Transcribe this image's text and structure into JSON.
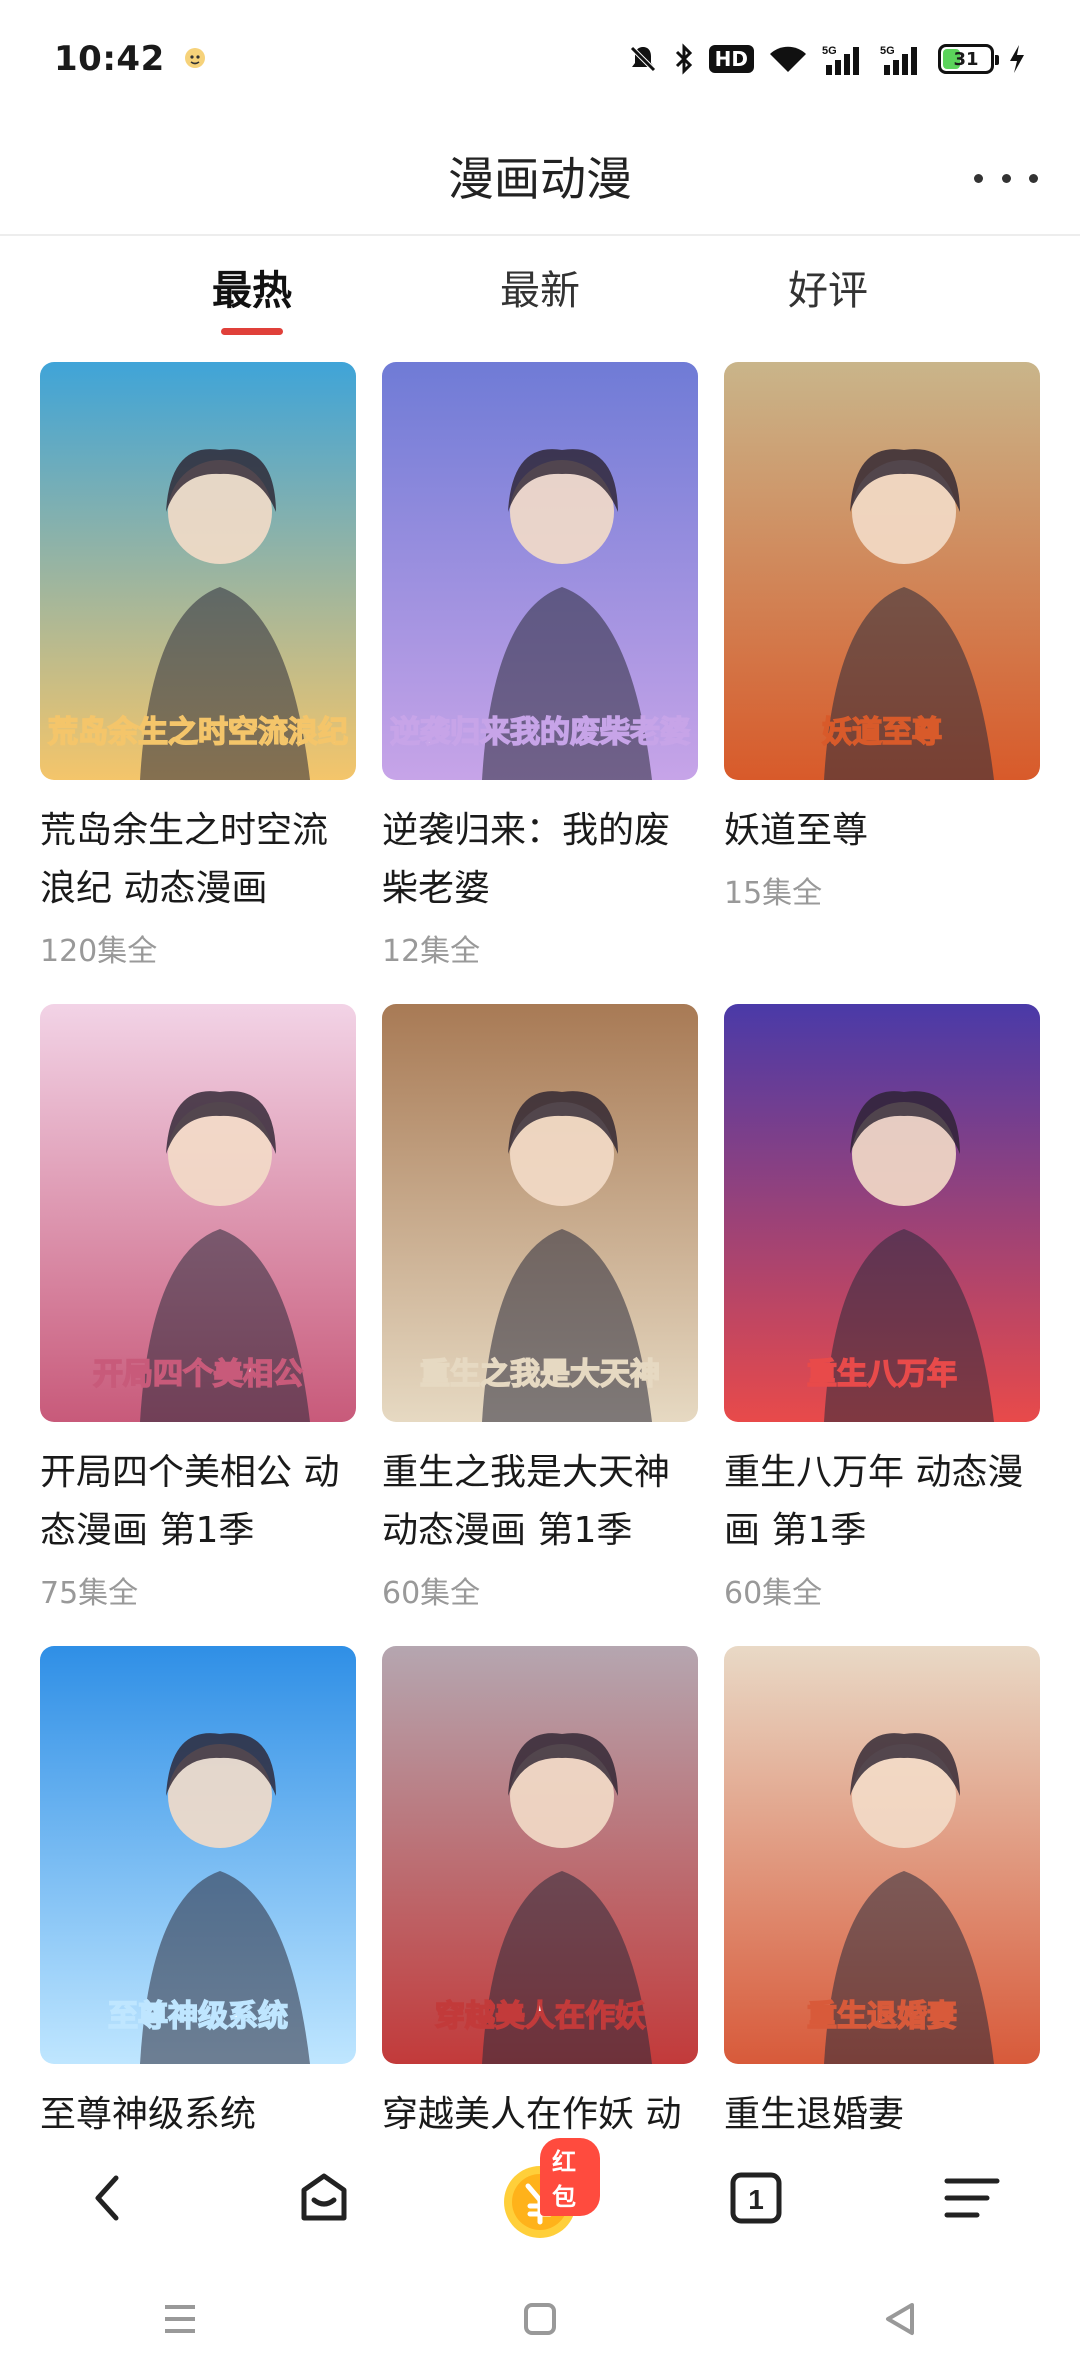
{
  "status_bar": {
    "time": "10:42",
    "network_badge": "HD",
    "signal_1": "5G",
    "signal_2": "5G",
    "battery_level": "31"
  },
  "header": {
    "title": "漫画动漫",
    "more_icon": "more-dots-icon"
  },
  "tabs": [
    {
      "label": "最热",
      "active": true
    },
    {
      "label": "最新",
      "active": false
    },
    {
      "label": "好评",
      "active": false
    }
  ],
  "items": [
    {
      "title": "荒岛余生之时空流浪纪 动态漫画",
      "episodes": "120集全"
    },
    {
      "title": "逆袭归来：我的废柴老婆",
      "episodes": "12集全"
    },
    {
      "title": "妖道至尊",
      "episodes": "15集全"
    },
    {
      "title": "开局四个美相公 动态漫画 第1季",
      "episodes": "75集全"
    },
    {
      "title": "重生之我是大天神 动态漫画 第1季",
      "episodes": "60集全"
    },
    {
      "title": "重生八万年 动态漫画 第1季",
      "episodes": "60集全"
    },
    {
      "title": "至尊神级系统",
      "episodes": ""
    },
    {
      "title": "穿越美人在作妖 动",
      "episodes": ""
    },
    {
      "title": "重生退婚妻",
      "episodes": ""
    }
  ],
  "covers": [
    {
      "caption": "荒岛余生之时空流浪纪",
      "accent": "#3fa4d8",
      "accent2": "#f4c56a"
    },
    {
      "caption": "逆袭归来我的废柴老婆",
      "accent": "#6f7bd6",
      "accent2": "#c7a4e8"
    },
    {
      "caption": "妖道至尊",
      "accent": "#c9b58a",
      "accent2": "#d85a2a"
    },
    {
      "caption": "开局四个美相公",
      "accent": "#f2d3e6",
      "accent2": "#c85a7a"
    },
    {
      "caption": "重生之我是大天神",
      "accent": "#a87a55",
      "accent2": "#e6d9c2"
    },
    {
      "caption": "重生八万年",
      "accent": "#4a3aa8",
      "accent2": "#e84a4a"
    },
    {
      "caption": "至尊神级系统",
      "accent": "#2f8fe6",
      "accent2": "#bfe6ff"
    },
    {
      "caption": "穿越美人在作妖",
      "accent": "#b5a6b0",
      "accent2": "#c23a3a"
    },
    {
      "caption": "重生退婚妻",
      "accent": "#e9d9c6",
      "accent2": "#d85a3a"
    }
  ],
  "bottom_nav": {
    "back_icon": "back-chevron-icon",
    "home_icon": "home-box-icon",
    "coin_icon": "coin-icon",
    "redpacket_label": "红包",
    "tabs_count": "1",
    "menu_icon": "menu-icon"
  },
  "colors": {
    "accent": "#e0403a",
    "coin": "#ffb21a"
  }
}
